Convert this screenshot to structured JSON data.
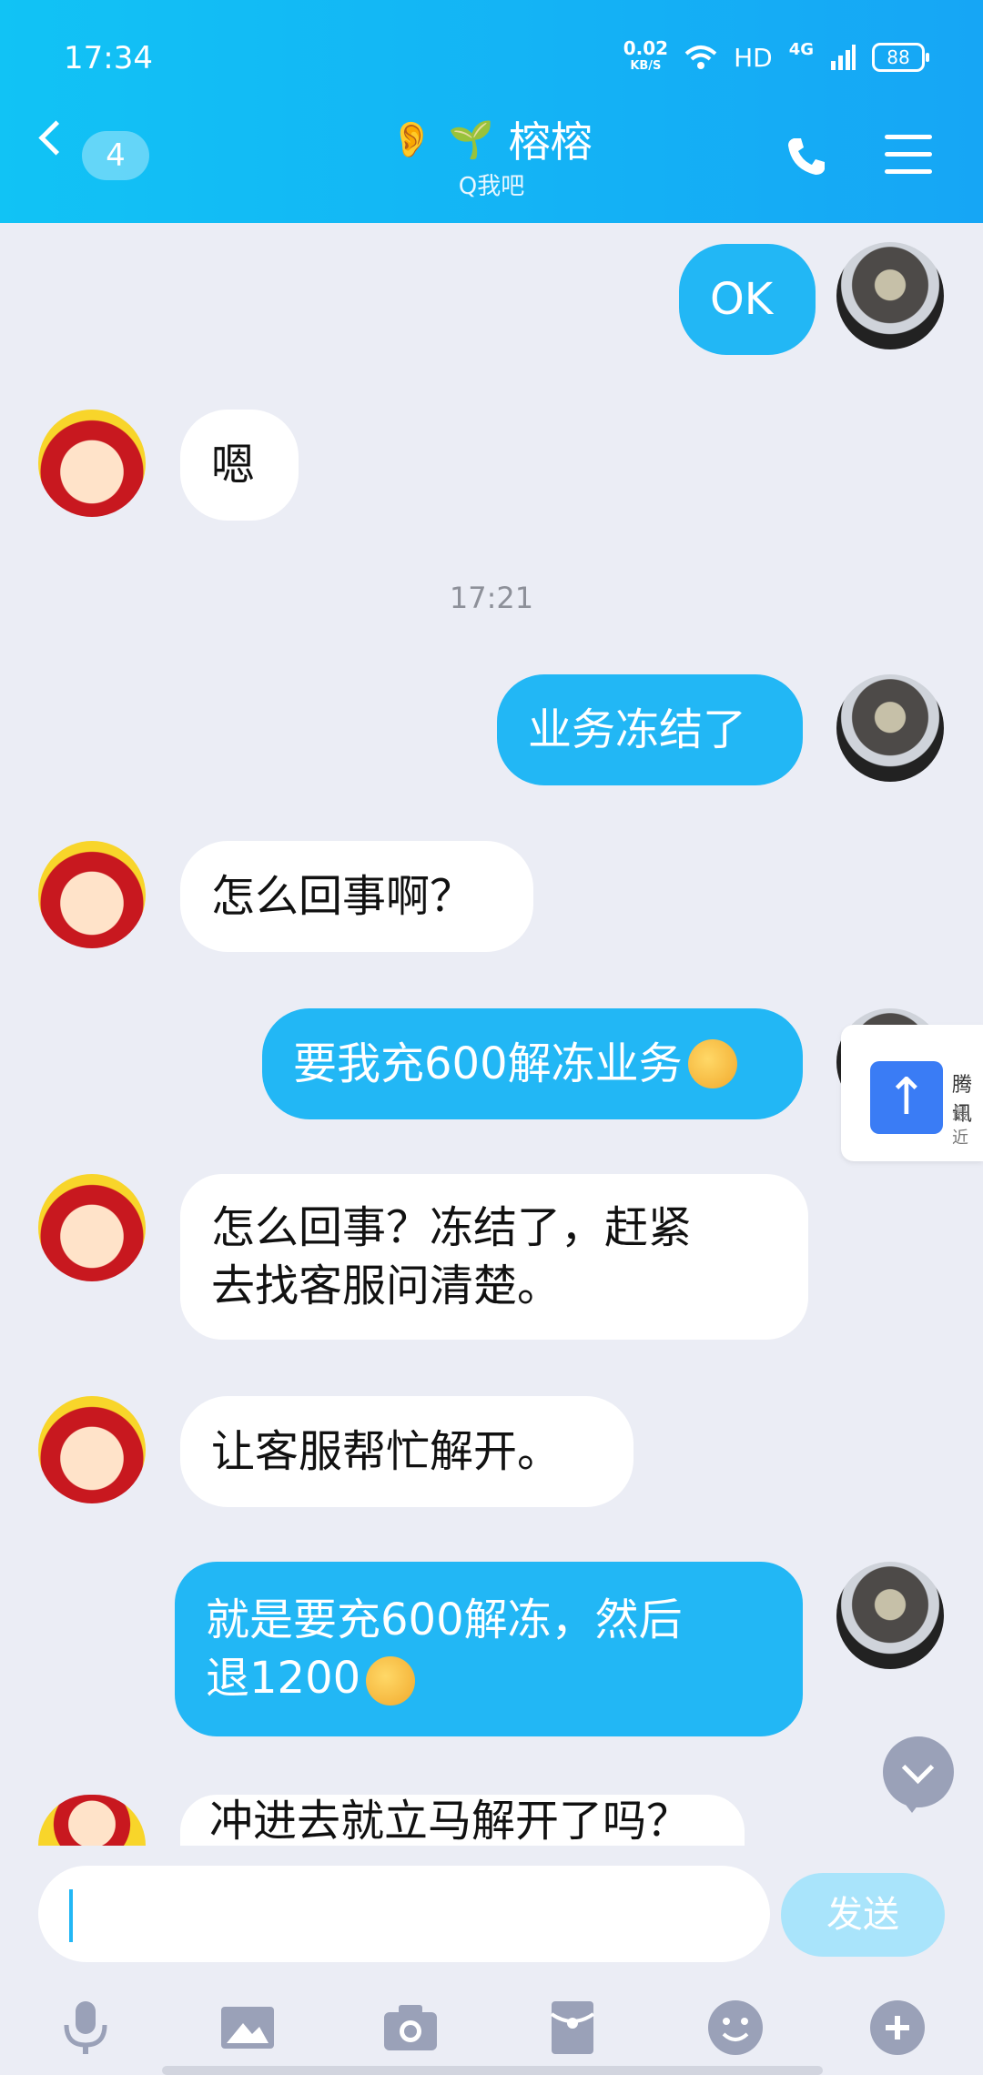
{
  "status": {
    "time": "17:34",
    "netspeed_value": "0.02",
    "netspeed_unit": "KB/S",
    "hd": "HD",
    "network": "4G",
    "battery": "88"
  },
  "header": {
    "unread_count": "4",
    "title": "榕榕",
    "subtitle": "Q我吧"
  },
  "messages": [
    {
      "side": "right",
      "text": "OK"
    },
    {
      "side": "left",
      "text": "嗯"
    },
    {
      "side": "right",
      "text": "业务冻结了"
    },
    {
      "side": "left",
      "text": "怎么回事啊？"
    },
    {
      "side": "right",
      "text": "要我充600解冻业务"
    },
    {
      "side": "left",
      "line1": "怎么回事？冻结了，赶紧",
      "line2": "去找客服问清楚。"
    },
    {
      "side": "left",
      "text": "让客服帮忙解开。"
    },
    {
      "side": "right",
      "line1": "就是要充600解冻，然后",
      "line2": "退1200"
    },
    {
      "side": "left",
      "text": "冲进去就立马解开了吗？"
    }
  ],
  "timestamp": "17:21",
  "floating_card": {
    "title": "腾讯",
    "subtitle": "最近"
  },
  "composer": {
    "send_label": "发送"
  },
  "toolbar": [
    "microphone-icon",
    "image-icon",
    "camera-icon",
    "red-packet-icon",
    "emoji-icon",
    "plus-icon"
  ]
}
